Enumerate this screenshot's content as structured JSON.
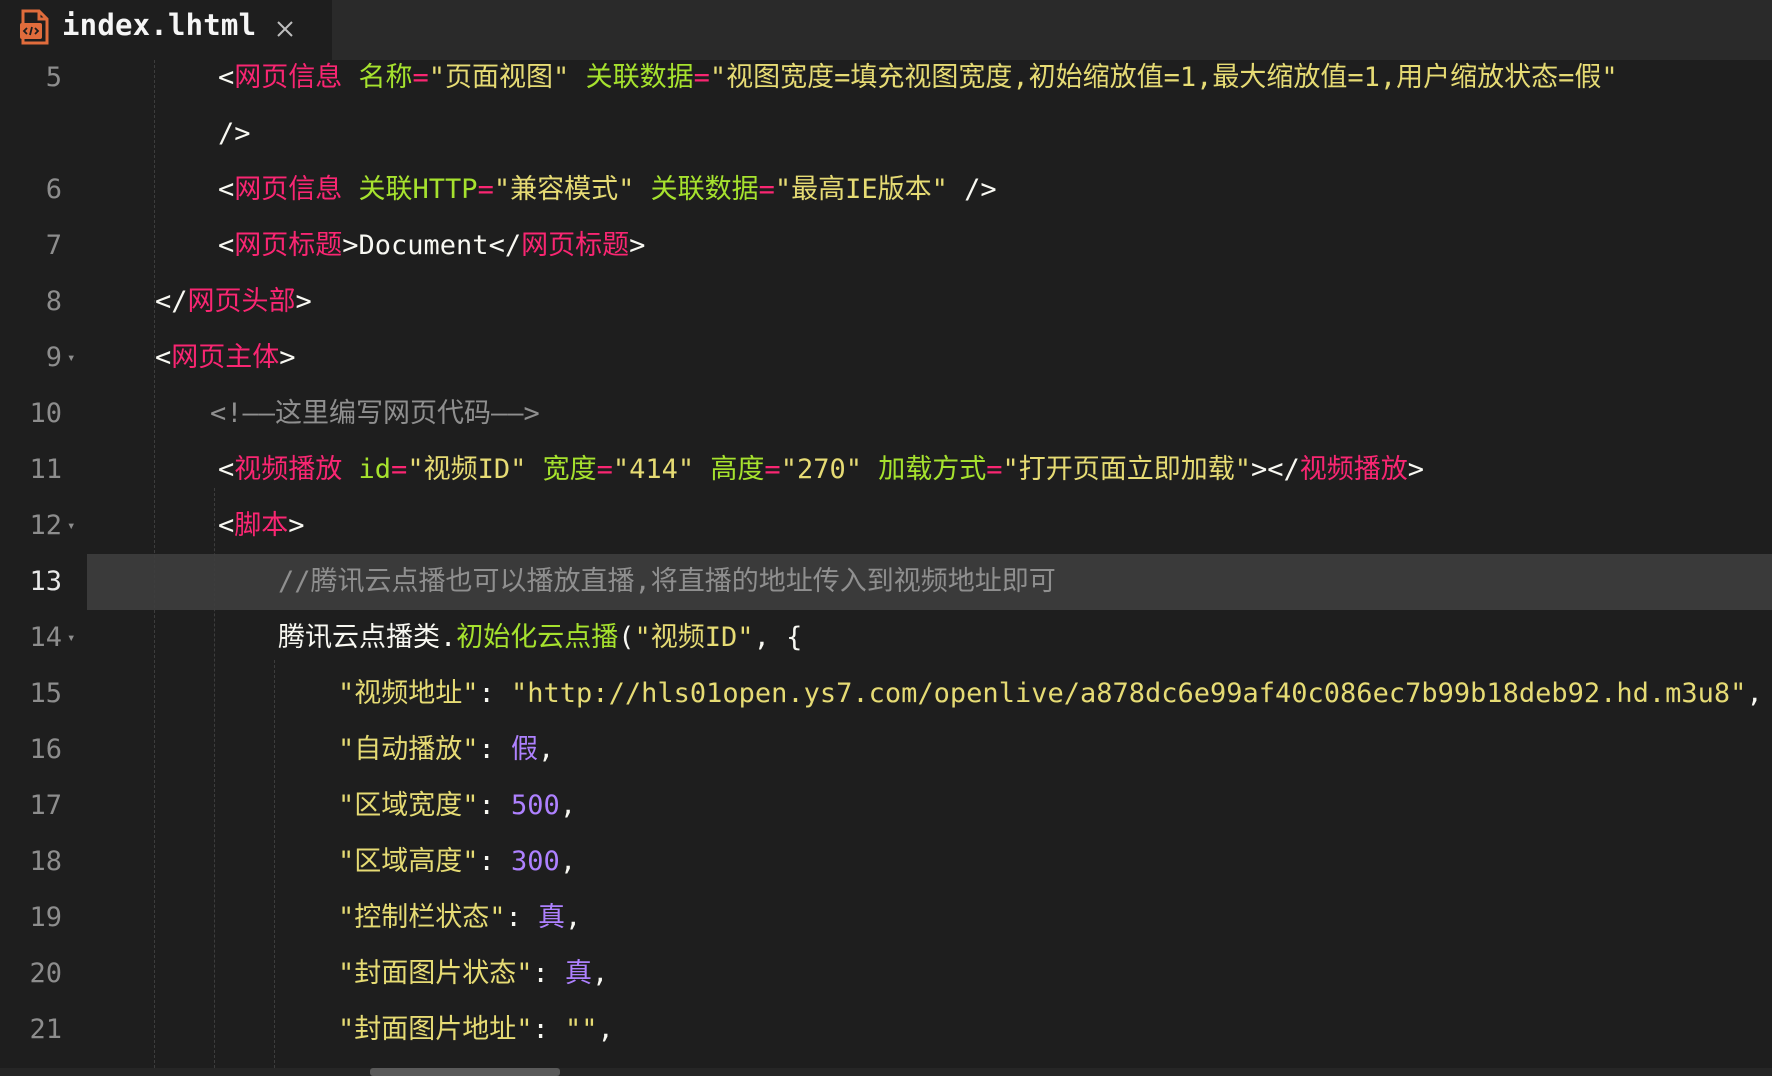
{
  "tab": {
    "filename": "index.lhtml",
    "file_icon": "html-file-icon",
    "close_icon": "close-icon"
  },
  "colors": {
    "background": "#1e1e1e",
    "tag": "#f92672",
    "attribute": "#a6e22e",
    "string": "#e6db74",
    "comment": "#8f8f8f",
    "number": "#ae81ff"
  },
  "lines": [
    {
      "num": "5",
      "segments": [
        {
          "k": "w",
          "t": "<"
        },
        {
          "k": "t",
          "t": "网页信息"
        },
        {
          "k": "w",
          "t": " "
        },
        {
          "k": "a",
          "t": "名称"
        },
        {
          "k": "t",
          "t": "="
        },
        {
          "k": "s",
          "t": "\"页面视图\""
        },
        {
          "k": "w",
          "t": " "
        },
        {
          "k": "a",
          "t": "关联数据"
        },
        {
          "k": "t",
          "t": "="
        },
        {
          "k": "s",
          "t": "\"视图宽度=填充视图宽度,初始缩放值=1,最大缩放值=1,用户缩放状态=假\""
        }
      ]
    },
    {
      "num": "",
      "segments": [
        {
          "k": "w",
          "t": "/>"
        }
      ]
    },
    {
      "num": "6",
      "segments": [
        {
          "k": "w",
          "t": "<"
        },
        {
          "k": "t",
          "t": "网页信息"
        },
        {
          "k": "w",
          "t": " "
        },
        {
          "k": "a",
          "t": "关联HTTP"
        },
        {
          "k": "t",
          "t": "="
        },
        {
          "k": "s",
          "t": "\"兼容模式\""
        },
        {
          "k": "w",
          "t": " "
        },
        {
          "k": "a",
          "t": "关联数据"
        },
        {
          "k": "t",
          "t": "="
        },
        {
          "k": "s",
          "t": "\"最高IE版本\""
        },
        {
          "k": "w",
          "t": " />"
        }
      ]
    },
    {
      "num": "7",
      "segments": [
        {
          "k": "w",
          "t": "<"
        },
        {
          "k": "t",
          "t": "网页标题"
        },
        {
          "k": "w",
          "t": ">Document</"
        },
        {
          "k": "t",
          "t": "网页标题"
        },
        {
          "k": "w",
          "t": ">"
        }
      ]
    },
    {
      "num": "8",
      "segments": [
        {
          "k": "w",
          "t": "</"
        },
        {
          "k": "t",
          "t": "网页头部"
        },
        {
          "k": "w",
          "t": ">"
        }
      ]
    },
    {
      "num": "9",
      "fold": true,
      "segments": [
        {
          "k": "w",
          "t": "<"
        },
        {
          "k": "t",
          "t": "网页主体"
        },
        {
          "k": "w",
          "t": ">"
        }
      ]
    },
    {
      "num": "10",
      "segments": [
        {
          "k": "c",
          "t": "<!——这里编写网页代码——>"
        }
      ]
    },
    {
      "num": "11",
      "segments": [
        {
          "k": "w",
          "t": "<"
        },
        {
          "k": "t",
          "t": "视频播放"
        },
        {
          "k": "w",
          "t": " "
        },
        {
          "k": "a",
          "t": "id"
        },
        {
          "k": "t",
          "t": "="
        },
        {
          "k": "s",
          "t": "\"视频ID\""
        },
        {
          "k": "w",
          "t": " "
        },
        {
          "k": "a",
          "t": "宽度"
        },
        {
          "k": "t",
          "t": "="
        },
        {
          "k": "s",
          "t": "\"414\""
        },
        {
          "k": "w",
          "t": " "
        },
        {
          "k": "a",
          "t": "高度"
        },
        {
          "k": "t",
          "t": "="
        },
        {
          "k": "s",
          "t": "\"270\""
        },
        {
          "k": "w",
          "t": " "
        },
        {
          "k": "a",
          "t": "加载方式"
        },
        {
          "k": "t",
          "t": "="
        },
        {
          "k": "s",
          "t": "\"打开页面立即加载\""
        },
        {
          "k": "w",
          "t": "></"
        },
        {
          "k": "t",
          "t": "视频播放"
        },
        {
          "k": "w",
          "t": ">"
        }
      ]
    },
    {
      "num": "12",
      "fold": true,
      "segments": [
        {
          "k": "w",
          "t": "<"
        },
        {
          "k": "t",
          "t": "脚本"
        },
        {
          "k": "w",
          "t": ">"
        }
      ]
    },
    {
      "num": "13",
      "current": true,
      "segments": [
        {
          "k": "c",
          "t": "//腾讯云点播也可以播放直播,将直播的地址传入到视频地址即可"
        }
      ]
    },
    {
      "num": "14",
      "fold": true,
      "segments": [
        {
          "k": "w",
          "t": "腾讯云点播类."
        },
        {
          "k": "a",
          "t": "初始化云点播"
        },
        {
          "k": "w",
          "t": "("
        },
        {
          "k": "s",
          "t": "\"视频ID\""
        },
        {
          "k": "w",
          "t": ", {"
        }
      ]
    },
    {
      "num": "15",
      "segments": [
        {
          "k": "s",
          "t": "\"视频地址\""
        },
        {
          "k": "w",
          "t": ": "
        },
        {
          "k": "s",
          "t": "\"http://hls01open.ys7.com/openlive/a878dc6e99af40c086ec7b99b18deb92.hd.m3u8\""
        },
        {
          "k": "w",
          "t": ","
        }
      ]
    },
    {
      "num": "16",
      "segments": [
        {
          "k": "s",
          "t": "\"自动播放\""
        },
        {
          "k": "w",
          "t": ": "
        },
        {
          "k": "n",
          "t": "假"
        },
        {
          "k": "w",
          "t": ","
        }
      ]
    },
    {
      "num": "17",
      "segments": [
        {
          "k": "s",
          "t": "\"区域宽度\""
        },
        {
          "k": "w",
          "t": ": "
        },
        {
          "k": "n",
          "t": "500"
        },
        {
          "k": "w",
          "t": ","
        }
      ]
    },
    {
      "num": "18",
      "segments": [
        {
          "k": "s",
          "t": "\"区域高度\""
        },
        {
          "k": "w",
          "t": ": "
        },
        {
          "k": "n",
          "t": "300"
        },
        {
          "k": "w",
          "t": ","
        }
      ]
    },
    {
      "num": "19",
      "segments": [
        {
          "k": "s",
          "t": "\"控制栏状态\""
        },
        {
          "k": "w",
          "t": ": "
        },
        {
          "k": "n",
          "t": "真"
        },
        {
          "k": "w",
          "t": ","
        }
      ]
    },
    {
      "num": "20",
      "segments": [
        {
          "k": "s",
          "t": "\"封面图片状态\""
        },
        {
          "k": "w",
          "t": ": "
        },
        {
          "k": "n",
          "t": "真"
        },
        {
          "k": "w",
          "t": ","
        }
      ]
    },
    {
      "num": "21",
      "segments": [
        {
          "k": "s",
          "t": "\"封面图片地址\""
        },
        {
          "k": "w",
          "t": ": "
        },
        {
          "k": "s",
          "t": "\"\""
        },
        {
          "k": "w",
          "t": ","
        }
      ]
    }
  ]
}
